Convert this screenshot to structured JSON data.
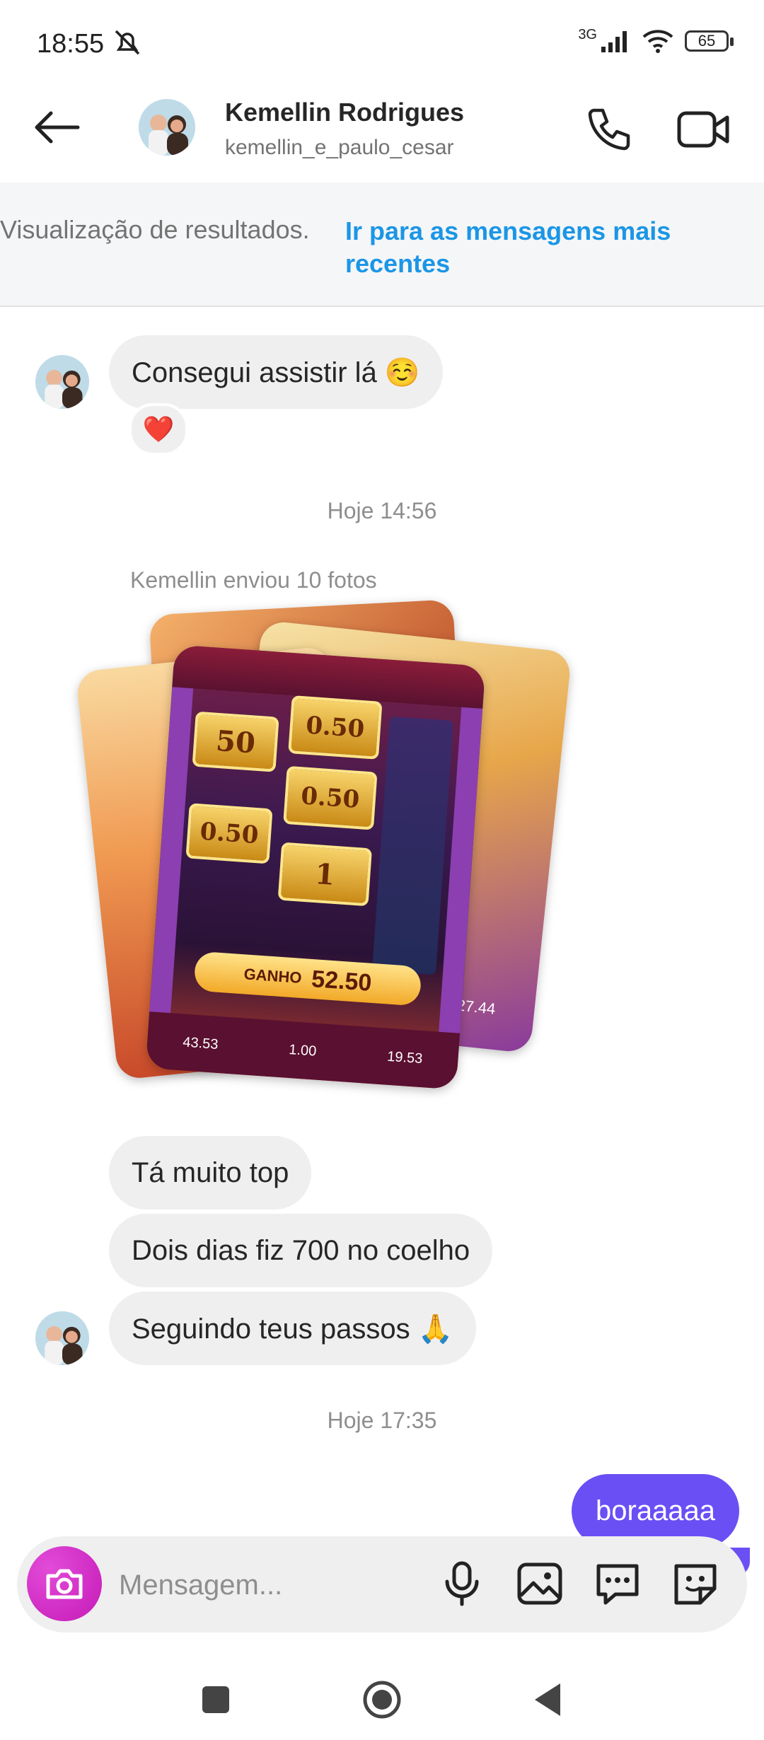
{
  "status_bar": {
    "time": "18:55",
    "network": "3G",
    "battery": "65"
  },
  "header": {
    "contact_name": "Kemellin Rodrigues",
    "username": "kemellin_e_paulo_cesar"
  },
  "banner": {
    "text": "Visualização de resultados.",
    "link": "Ir para as mensagens mais recentes"
  },
  "messages": {
    "m1": "Consegui assistir lá ☺️",
    "reaction": "❤️",
    "time1": "Hoje 14:56",
    "photos_caption": "Kemellin enviou 10 fotos",
    "m2": "Tá muito top",
    "m3": "Dois dias fiz 700 no coelho",
    "m4": "Seguindo teus passos 🙏",
    "time2": "Hoje 17:35",
    "m5": "boraaaaa"
  },
  "photo": {
    "reel_values": [
      "50",
      "0.50",
      "0.50",
      "0.50",
      "1"
    ],
    "win_label": "GANHO",
    "win_value": "52.50",
    "footer_values": [
      "43.53",
      "1.00",
      "19.53"
    ],
    "side_value": "27.44"
  },
  "composer": {
    "placeholder": "Mensagem..."
  },
  "icons": {
    "back": "arrow-left-icon",
    "call": "phone-icon",
    "video": "video-camera-icon",
    "camera": "camera-icon",
    "mic": "microphone-icon",
    "gallery": "image-icon",
    "chat": "chat-bubble-icon",
    "sticker": "sticker-icon"
  },
  "colors": {
    "accent_link": "#1b96e6",
    "outgoing_bubble": "#6a4ff5",
    "camera_button": "#c51ab8"
  }
}
